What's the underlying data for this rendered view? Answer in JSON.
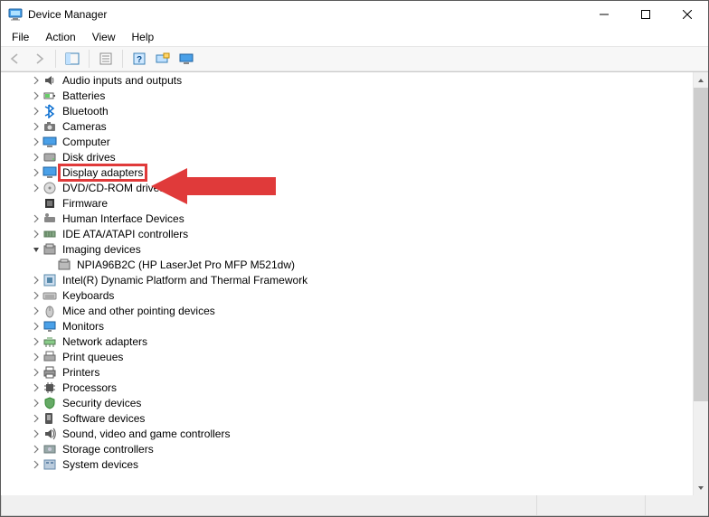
{
  "window": {
    "title": "Device Manager"
  },
  "menubar": {
    "items": [
      "File",
      "Action",
      "View",
      "Help"
    ]
  },
  "toolbar": {
    "buttons": [
      {
        "name": "back-button",
        "enabled": false
      },
      {
        "name": "forward-button",
        "enabled": false
      },
      {
        "name": "show-hide-console-tree-button",
        "enabled": true
      },
      {
        "name": "properties-button",
        "enabled": true
      },
      {
        "name": "help-button",
        "enabled": true
      },
      {
        "name": "scan-hardware-button",
        "enabled": true
      },
      {
        "name": "monitor-icon-button",
        "enabled": true
      }
    ]
  },
  "tree": {
    "nodes": [
      {
        "level": 1,
        "expand": "closed",
        "icon": "audio-icon",
        "label": "Audio inputs and outputs",
        "highlighted": false
      },
      {
        "level": 1,
        "expand": "closed",
        "icon": "battery-icon",
        "label": "Batteries",
        "highlighted": false
      },
      {
        "level": 1,
        "expand": "closed",
        "icon": "bluetooth-icon",
        "label": "Bluetooth",
        "highlighted": false
      },
      {
        "level": 1,
        "expand": "closed",
        "icon": "camera-icon",
        "label": "Cameras",
        "highlighted": false
      },
      {
        "level": 1,
        "expand": "closed",
        "icon": "computer-icon",
        "label": "Computer",
        "highlighted": false
      },
      {
        "level": 1,
        "expand": "closed",
        "icon": "disk-icon",
        "label": "Disk drives",
        "highlighted": false
      },
      {
        "level": 1,
        "expand": "closed",
        "icon": "display-icon",
        "label": "Display adapters",
        "highlighted": true
      },
      {
        "level": 1,
        "expand": "closed",
        "icon": "dvd-icon",
        "label": "DVD/CD-ROM drives",
        "highlighted": false
      },
      {
        "level": 1,
        "expand": "none",
        "icon": "firmware-icon",
        "label": "Firmware",
        "highlighted": false
      },
      {
        "level": 1,
        "expand": "closed",
        "icon": "hid-icon",
        "label": "Human Interface Devices",
        "highlighted": false
      },
      {
        "level": 1,
        "expand": "closed",
        "icon": "ide-icon",
        "label": "IDE ATA/ATAPI controllers",
        "highlighted": false
      },
      {
        "level": 1,
        "expand": "open",
        "icon": "imaging-icon",
        "label": "Imaging devices",
        "highlighted": false
      },
      {
        "level": 2,
        "expand": "none",
        "icon": "device-icon",
        "label": "NPIA96B2C (HP LaserJet Pro MFP M521dw)",
        "highlighted": false
      },
      {
        "level": 1,
        "expand": "closed",
        "icon": "platform-icon",
        "label": "Intel(R) Dynamic Platform and Thermal Framework",
        "highlighted": false
      },
      {
        "level": 1,
        "expand": "closed",
        "icon": "keyboard-icon",
        "label": "Keyboards",
        "highlighted": false
      },
      {
        "level": 1,
        "expand": "closed",
        "icon": "mouse-icon",
        "label": "Mice and other pointing devices",
        "highlighted": false
      },
      {
        "level": 1,
        "expand": "closed",
        "icon": "monitor-icon",
        "label": "Monitors",
        "highlighted": false
      },
      {
        "level": 1,
        "expand": "closed",
        "icon": "network-icon",
        "label": "Network adapters",
        "highlighted": false
      },
      {
        "level": 1,
        "expand": "closed",
        "icon": "printqueue-icon",
        "label": "Print queues",
        "highlighted": false
      },
      {
        "level": 1,
        "expand": "closed",
        "icon": "printer-icon",
        "label": "Printers",
        "highlighted": false
      },
      {
        "level": 1,
        "expand": "closed",
        "icon": "processor-icon",
        "label": "Processors",
        "highlighted": false
      },
      {
        "level": 1,
        "expand": "closed",
        "icon": "security-icon",
        "label": "Security devices",
        "highlighted": false
      },
      {
        "level": 1,
        "expand": "closed",
        "icon": "software-icon",
        "label": "Software devices",
        "highlighted": false
      },
      {
        "level": 1,
        "expand": "closed",
        "icon": "sound-icon",
        "label": "Sound, video and game controllers",
        "highlighted": false
      },
      {
        "level": 1,
        "expand": "closed",
        "icon": "storage-icon",
        "label": "Storage controllers",
        "highlighted": false
      },
      {
        "level": 1,
        "expand": "closed",
        "icon": "system-icon",
        "label": "System devices",
        "highlighted": false
      }
    ]
  }
}
